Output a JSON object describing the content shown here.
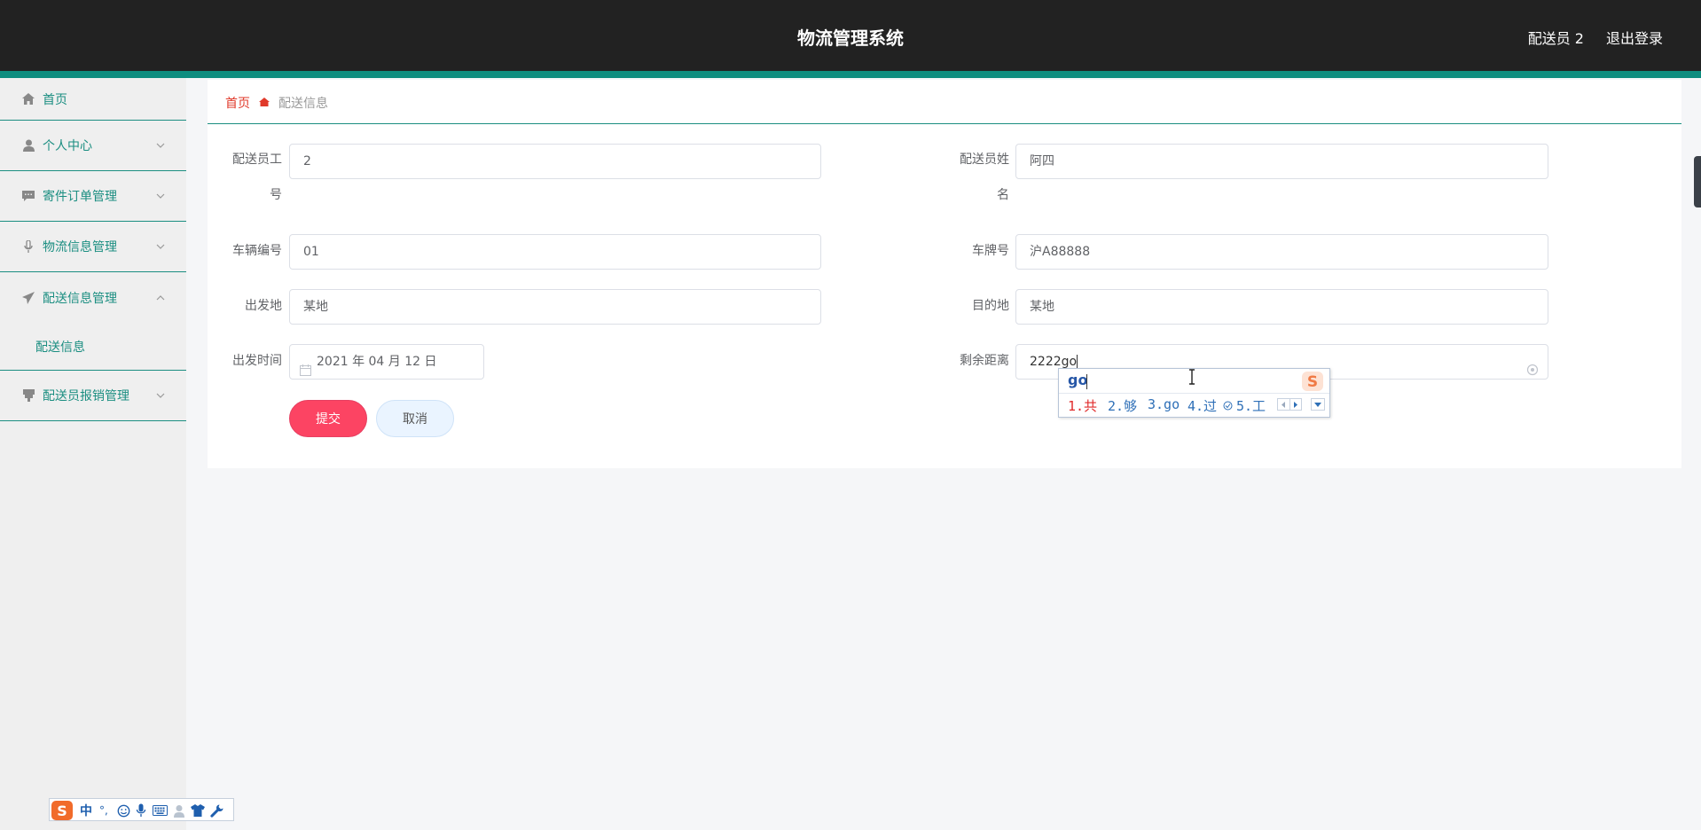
{
  "header": {
    "title": "物流管理系统",
    "user": "配送员 2",
    "logout": "退出登录"
  },
  "sidebar": {
    "items": [
      {
        "label": "首页",
        "icon": "home-icon"
      },
      {
        "label": "个人中心",
        "icon": "user-icon"
      },
      {
        "label": "寄件订单管理",
        "icon": "chat-icon"
      },
      {
        "label": "物流信息管理",
        "icon": "microphone-icon"
      },
      {
        "label": "配送信息管理",
        "icon": "paper-plane-icon"
      },
      {
        "label": "配送员报销管理",
        "icon": "receipt-icon"
      }
    ],
    "subitem": "配送信息"
  },
  "breadcrumb": {
    "home": "首页",
    "current": "配送信息"
  },
  "form": {
    "courier_id": {
      "label_line1": "配送员工",
      "label_line2": "号",
      "value": "2"
    },
    "courier_name": {
      "label_line1": "配送员姓",
      "label_line2": "名",
      "value": "阿四"
    },
    "vehicle_no": {
      "label": "车辆编号",
      "value": "01"
    },
    "plate_no": {
      "label": "车牌号",
      "value": "沪A88888"
    },
    "origin": {
      "label": "出发地",
      "value": "某地"
    },
    "destination": {
      "label": "目的地",
      "value": "某地"
    },
    "depart_time": {
      "label": "出发时间",
      "value": "2021 年 04 月 12 日"
    },
    "remaining_distance": {
      "label": "剩余距离",
      "value": "2222go"
    },
    "submit": "提交",
    "cancel": "取消"
  },
  "ime": {
    "composition": "go",
    "candidates": [
      "1.共",
      "2.够",
      "3.go",
      "4.过",
      "5.工"
    ]
  },
  "ime_toolbar": {
    "mode": "中",
    "punct": "°,"
  },
  "colors": {
    "header_bg": "#222222",
    "accent": "#0e8d7f",
    "submit": "#fc4463",
    "breadcrumb_home": "#e0392a"
  }
}
